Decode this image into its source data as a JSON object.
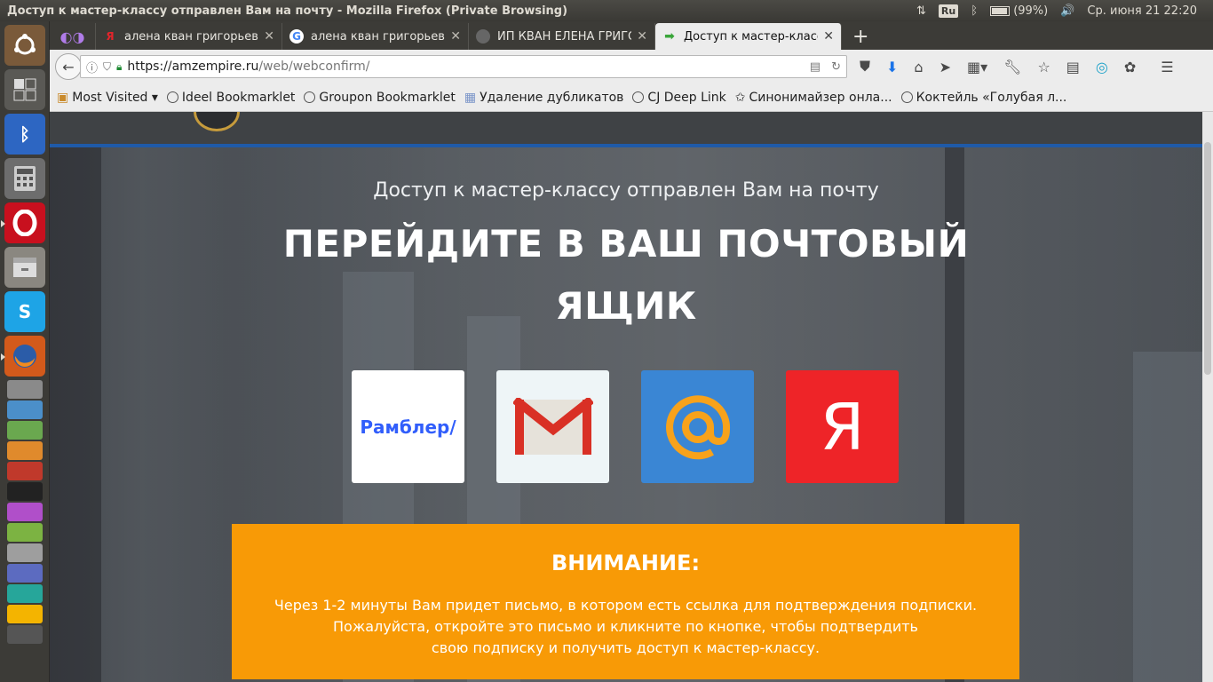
{
  "system_panel": {
    "window_title": "Доступ к мастер-классу отправлен Вам на почту - Mozilla Firefox (Private Browsing)",
    "keyboard_layout": "Ru",
    "battery": "(99%)",
    "datetime": "Ср. июня 21 22:20"
  },
  "tabs": [
    {
      "title": "алена кван григорьева",
      "favicon": "yandex-icon",
      "active": false
    },
    {
      "title": "алена кван григорьева",
      "favicon": "google-icon",
      "active": false
    },
    {
      "title": "ИП КВАН ЕЛЕНА ГРИГОРЬЕВНА",
      "favicon": "globe-icon",
      "active": false
    },
    {
      "title": "Доступ к мастер-классу",
      "favicon": "arrow-icon",
      "active": true
    }
  ],
  "navbar": {
    "url_host": "https://amzempire.ru",
    "url_path": "/web/webconfirm/"
  },
  "bookmarks": [
    {
      "label": "Most Visited ▾",
      "icon": "folder-icon"
    },
    {
      "label": "Ideel Bookmarklet",
      "icon": "globe-icon"
    },
    {
      "label": "Groupon Bookmarklet",
      "icon": "globe-icon"
    },
    {
      "label": "Удаление дубликатов",
      "icon": "page-icon"
    },
    {
      "label": "CJ Deep Link",
      "icon": "globe-icon"
    },
    {
      "label": "Синонимайзер онла...",
      "icon": "star-icon"
    },
    {
      "label": "Коктейль «Голубая л...",
      "icon": "globe-icon"
    }
  ],
  "page": {
    "subtitle": "Доступ к мастер-классу отправлен Вам на почту",
    "headline": "ПЕРЕЙДИТЕ В ВАШ ПОЧТОВЫЙ ЯЩИК",
    "mail_services": {
      "rambler_label": "Рамблер/",
      "yandex_letter": "Я"
    },
    "notice": {
      "title": "ВНИМАНИЕ:",
      "line1": "Через 1-2 минуты Вам придет письмо, в котором есть ссылка для подтверждения подписки.",
      "line2": "Пожалуйста, откройте это письмо и кликните по кнопке, чтобы подтвердить",
      "line3": "свою подписку и получить доступ к мастер-классу."
    }
  },
  "colors": {
    "notice_bg": "#f89a06",
    "header_accent": "#1f5aa8",
    "rambler_blue": "#315efb",
    "mailru_blue": "#3a86d4",
    "yandex_red": "#ee2428"
  }
}
